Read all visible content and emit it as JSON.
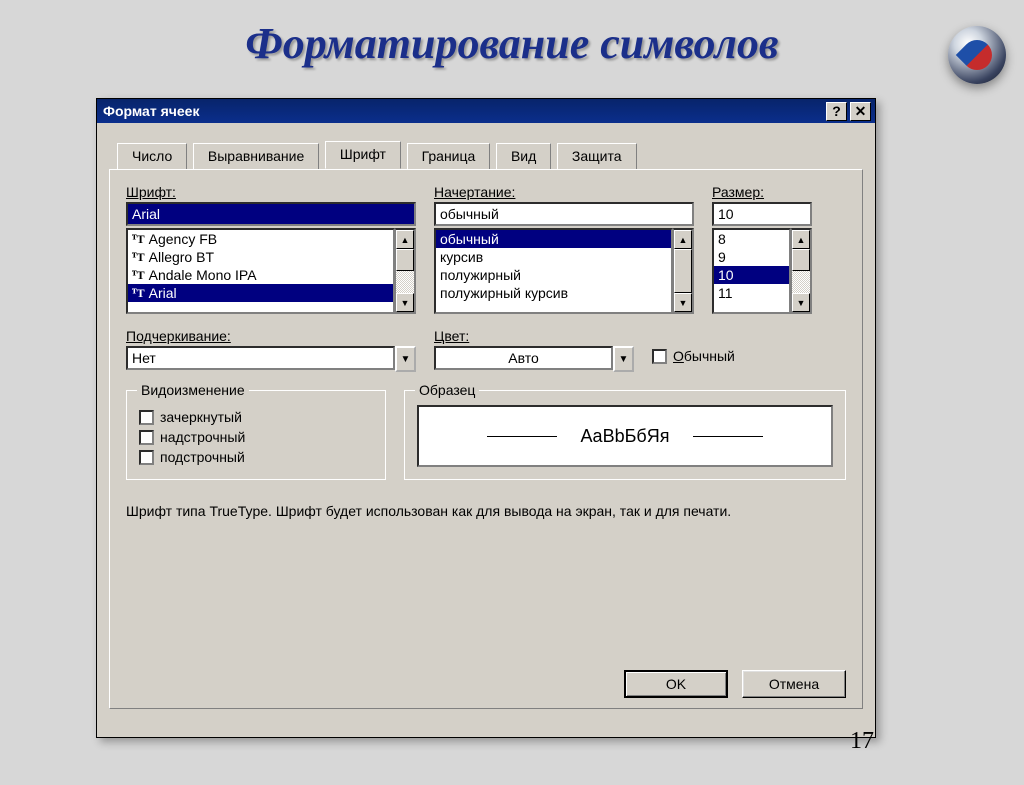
{
  "slide": {
    "title": "Форматирование символов",
    "page_number": "17"
  },
  "dialog": {
    "title": "Формат ячеек",
    "help_btn": "?",
    "close_btn": "✕",
    "tabs": [
      "Число",
      "Выравнивание",
      "Шрифт",
      "Граница",
      "Вид",
      "Защита"
    ],
    "active_tab_index": 2,
    "font": {
      "label": "Шрифт:",
      "value": "Arial",
      "list": [
        "Agency FB",
        "Allegro BT",
        "Andale Mono IPA",
        "Arial"
      ],
      "selected_index": 3
    },
    "style": {
      "label": "Начертание:",
      "value": "обычный",
      "list": [
        "обычный",
        "курсив",
        "полужирный",
        "полужирный курсив"
      ],
      "selected_index": 0
    },
    "size": {
      "label": "Размер:",
      "value": "10",
      "list": [
        "8",
        "9",
        "10",
        "11"
      ],
      "selected_index": 2
    },
    "underline": {
      "label": "Подчеркивание:",
      "value": "Нет"
    },
    "color": {
      "label": "Цвет:",
      "value": "Авто"
    },
    "normal_chk": "Обычный",
    "effects": {
      "legend": "Видоизменение",
      "items": [
        "зачеркнутый",
        "надстрочный",
        "подстрочный"
      ]
    },
    "sample": {
      "legend": "Образец",
      "text": "AaBbБбЯя"
    },
    "hint": "Шрифт типа TrueType. Шрифт будет использован как для вывода на экран, так и для печати.",
    "ok": "OK",
    "cancel": "Отмена"
  }
}
